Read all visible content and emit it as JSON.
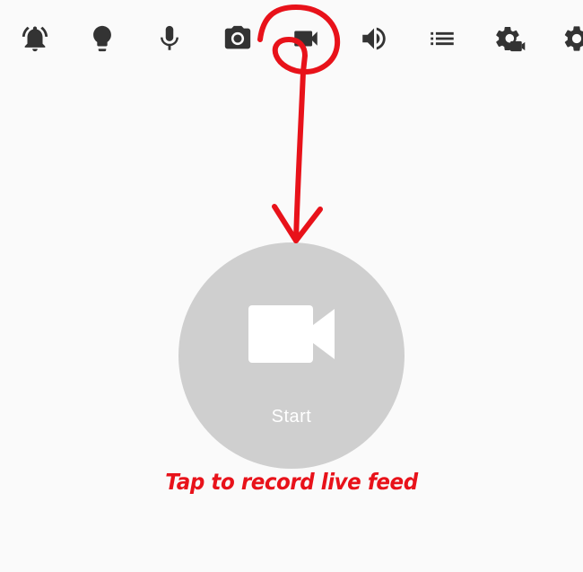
{
  "toolbar": {
    "items": [
      {
        "icon": "alarm-bell-icon"
      },
      {
        "icon": "lightbulb-icon"
      },
      {
        "icon": "microphone-icon"
      },
      {
        "icon": "camera-icon"
      },
      {
        "icon": "videocam-icon",
        "selected": true
      },
      {
        "icon": "volume-icon"
      },
      {
        "icon": "list-icon"
      },
      {
        "icon": "gear-video-icon"
      },
      {
        "icon": "settings-icon"
      }
    ]
  },
  "record": {
    "icon": "videocam-icon",
    "label": "Start"
  },
  "annotation": {
    "caption": "Tap to record live feed",
    "color": "#e8121a"
  },
  "colors": {
    "icon": "#333333",
    "circle": "#cfcfcf",
    "background": "#fafafa"
  }
}
